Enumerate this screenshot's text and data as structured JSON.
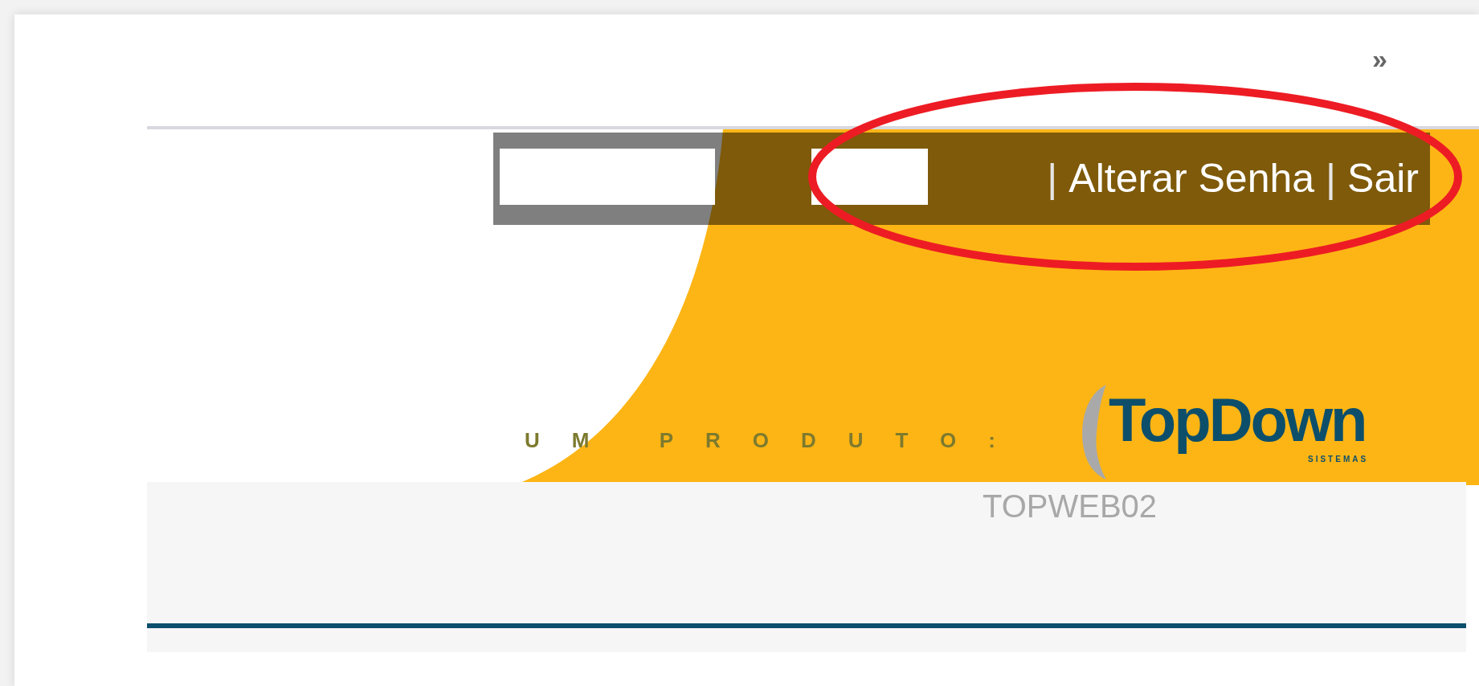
{
  "nav_toggle": "»",
  "header": {
    "user_links": [
      {
        "kind": "separator",
        "text": "|"
      },
      {
        "kind": "link",
        "text": "Alterar Senha"
      },
      {
        "kind": "separator",
        "text": "|"
      },
      {
        "kind": "link",
        "text": "Sair"
      }
    ],
    "tagline": "UM PRODUTO:",
    "logo": {
      "name": "TopDown",
      "subtitle": "SISTEMAS"
    },
    "server": "TOPWEB02"
  }
}
